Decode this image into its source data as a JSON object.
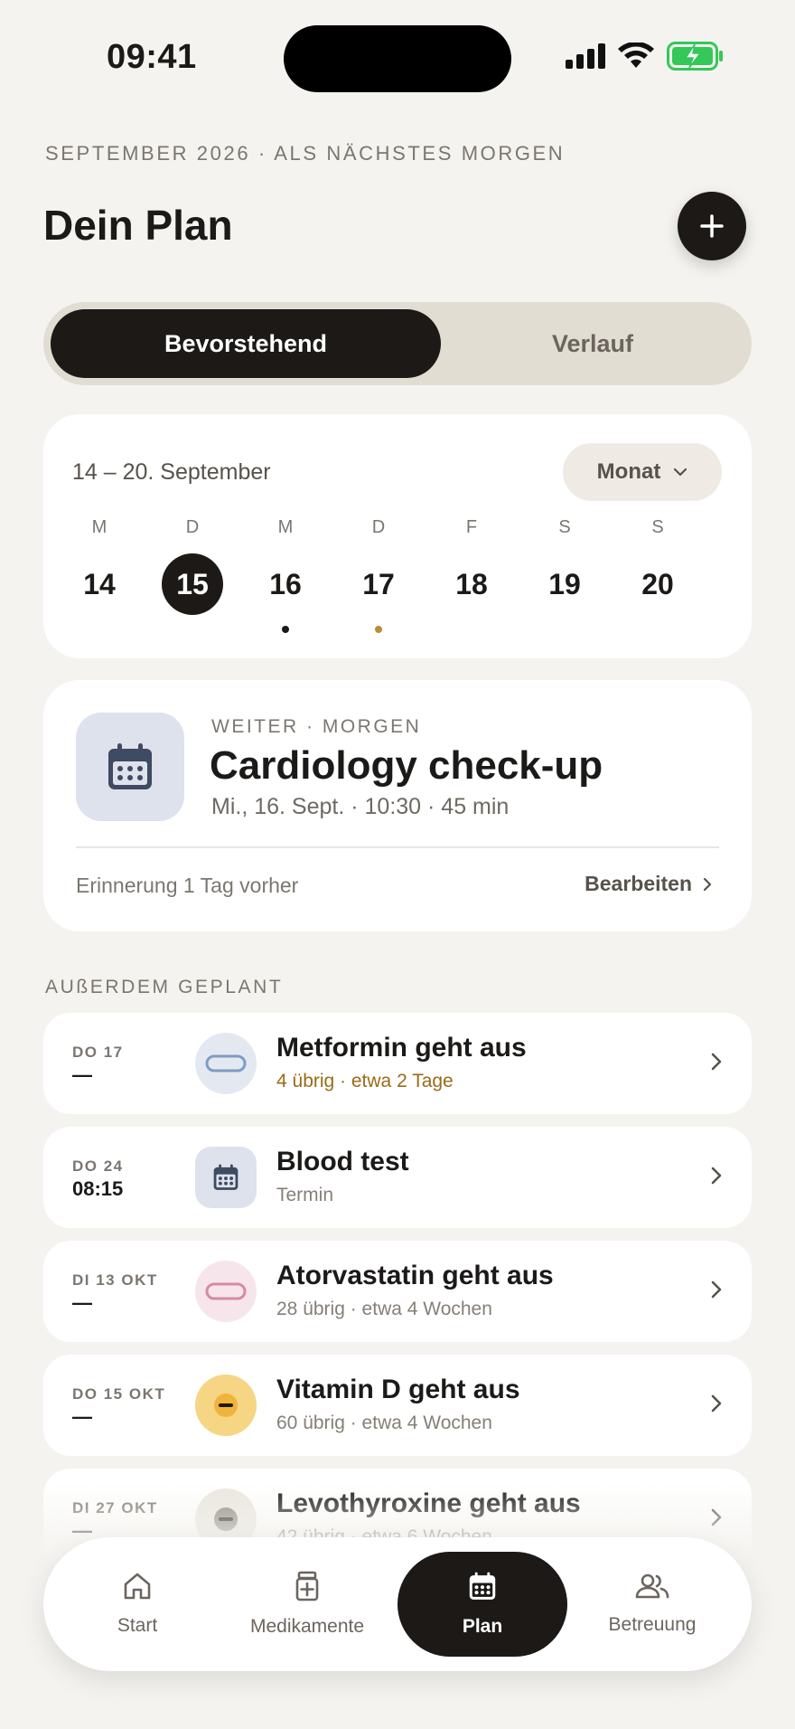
{
  "status": {
    "time": "09:41"
  },
  "header": {
    "overline": "SEPTEMBER 2026 · ALS NÄCHSTES MORGEN",
    "title": "Dein Plan"
  },
  "segment": {
    "active": "Bevorstehend",
    "inactive": "Verlauf"
  },
  "week": {
    "range": "14 – 20. September",
    "view_label": "Monat",
    "days": [
      {
        "letter": "M",
        "num": "14",
        "selected": false,
        "dot": ""
      },
      {
        "letter": "D",
        "num": "15",
        "selected": true,
        "dot": ""
      },
      {
        "letter": "M",
        "num": "16",
        "selected": false,
        "dot": "#1c1917"
      },
      {
        "letter": "D",
        "num": "17",
        "selected": false,
        "dot": "#c08a3e"
      },
      {
        "letter": "F",
        "num": "18",
        "selected": false,
        "dot": ""
      },
      {
        "letter": "S",
        "num": "19",
        "selected": false,
        "dot": ""
      },
      {
        "letter": "S",
        "num": "20",
        "selected": false,
        "dot": ""
      }
    ]
  },
  "next": {
    "overline": "WEITER · MORGEN",
    "title": "Cardiology check-up",
    "meta": "Mi., 16. Sept. · 10:30 · 45 min",
    "reminder": "Erinnerung 1 Tag vorher",
    "edit": "Bearbeiten"
  },
  "section_label": "AUßERDEM GEPLANT",
  "items": [
    {
      "date": "DO 17",
      "time": "—",
      "title": "Metformin geht aus",
      "sub": "4 übrig · etwa 2 Tage",
      "icon": "pill-capsule-icon"
    },
    {
      "date": "DO 24",
      "time": "08:15",
      "title": "Blood test",
      "sub": "Termin",
      "icon": "calendar-icon"
    },
    {
      "date": "DI 13 OKT",
      "time": "—",
      "title": "Atorvastatin geht aus",
      "sub": "28 übrig · etwa 4 Wochen",
      "icon": "pill-capsule-icon"
    },
    {
      "date": "DO 15 OKT",
      "time": "—",
      "title": "Vitamin D geht aus",
      "sub": "60 übrig · etwa 4 Wochen",
      "icon": "pill-tablet-icon"
    },
    {
      "date": "DI 27 OKT",
      "time": "—",
      "title": "Levothyroxine geht aus",
      "sub": "42 übrig · etwa 6 Wochen",
      "icon": "pill-tablet-icon"
    }
  ],
  "tabs": [
    {
      "label": "Start",
      "icon": "home-icon"
    },
    {
      "label": "Medikamente",
      "icon": "medicine-icon"
    },
    {
      "label": "Plan",
      "icon": "calendar-icon"
    },
    {
      "label": "Betreuung",
      "icon": "people-icon"
    }
  ],
  "colors": {
    "accent_dark": "#1c1917",
    "background": "#f4f3ef",
    "warning_text": "#9a6b17",
    "battery": "#34c759"
  }
}
